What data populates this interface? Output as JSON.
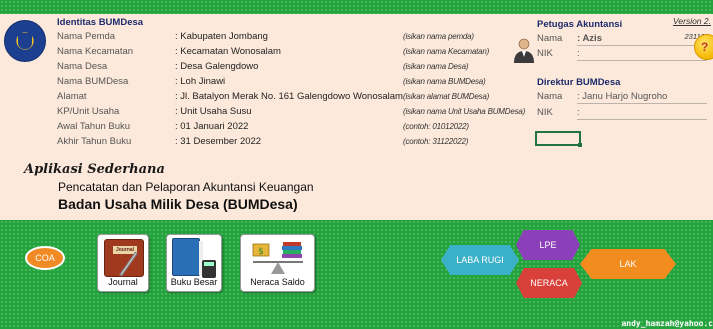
{
  "header": {
    "title": "Identitas BUMDesa",
    "version": "Version 2.",
    "version_code": "231102"
  },
  "identity": {
    "rows": [
      {
        "label": "Nama Pemda",
        "value": ": Kabupaten Jombang",
        "hint": "(isikan nama pemda)"
      },
      {
        "label": "Nama Kecamatan",
        "value": ": Kecamatan Wonosalam",
        "hint": "(isikan nama Kecamatan)"
      },
      {
        "label": "Nama Desa",
        "value": ": Desa Galengdowo",
        "hint": "(isikan nama Desa)"
      },
      {
        "label": "Nama BUMDesa",
        "value": ": Loh Jinawi",
        "hint": "(isikan nama BUMDesa)"
      },
      {
        "label": "Alamat",
        "value": ": Jl. Batalyon Merak No. 161 Galengdowo Wonosalam",
        "hint": "(isikan alamat BUMDesa)"
      },
      {
        "label": "KP/Unit Usaha",
        "value": ": Unit Usaha Susu",
        "hint": "(isikan nama Unit Usaha BUMDesa)"
      },
      {
        "label": "Awal Tahun Buku",
        "value": ": 01 Januari 2022",
        "hint": "(contoh: 01012022)"
      },
      {
        "label": "Akhir Tahun Buku",
        "value": ": 31 Desember 2022",
        "hint": "(contoh: 31122022)"
      }
    ]
  },
  "petugas": {
    "title": "Petugas Akuntansi",
    "nama_label": "Nama",
    "nama_value": ": Azis",
    "nik_label": "NIK",
    "nik_value": ":"
  },
  "direktur": {
    "title": "Direktur BUMDesa",
    "nama_label": "Nama",
    "nama_value": ": Janu Harjo Nugroho",
    "nik_label": "NIK",
    "nik_value": ":"
  },
  "help": {
    "label": "?"
  },
  "app": {
    "title": "Aplikasi Sederhana",
    "subtitle1": "Pencatatan dan Pelaporan Akuntansi Keuangan",
    "subtitle2": "Badan Usaha Milik Desa (BUMDesa)"
  },
  "buttons": {
    "coa": "COA",
    "journal": "Journal",
    "journal_tag": "Journal",
    "buku_besar": "Buku Besar",
    "neraca_saldo": "Neraca Saldo",
    "laba_rugi": "LABA RUGI",
    "lpe": "LPE",
    "neraca": "NERACA",
    "lak": "LAK"
  },
  "colors": {
    "laba_rugi": "#3bb1c9",
    "lpe": "#8b3fb8",
    "neraca": "#d9403a",
    "lak": "#f28c1e"
  },
  "footer": {
    "email": "andy_hamzah@yahoo.c"
  }
}
